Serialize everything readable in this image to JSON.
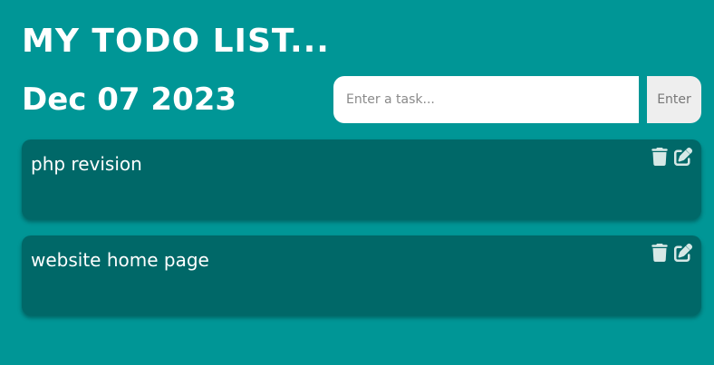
{
  "header": {
    "title": "MY TODO LIST...",
    "date": "Dec 07 2023"
  },
  "task_input": {
    "placeholder": "Enter a task...",
    "value": "",
    "button_label": "Enter"
  },
  "tasks": [
    {
      "text": "php revision",
      "delete_icon": "trash-icon",
      "edit_icon": "edit-icon"
    },
    {
      "text": "website home page",
      "delete_icon": "trash-icon",
      "edit_icon": "edit-icon"
    }
  ],
  "colors": {
    "background": "#009696",
    "card": "#006868",
    "text": "#ffffff",
    "icon": "#d6e8e6",
    "button_bg": "#eeeeee"
  }
}
